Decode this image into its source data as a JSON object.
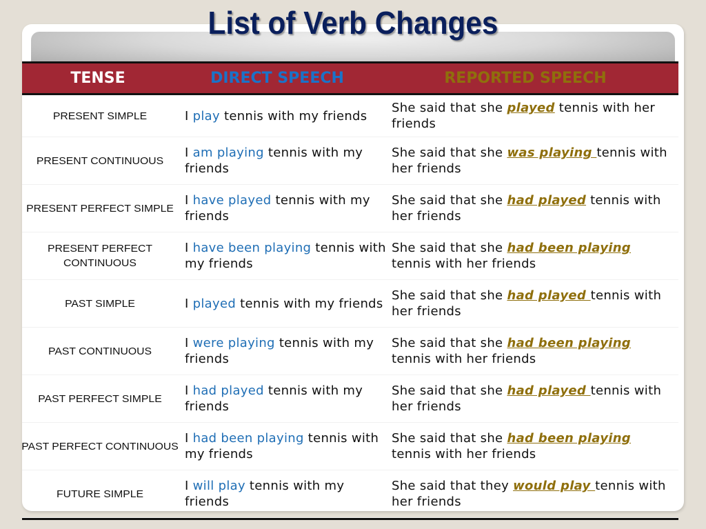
{
  "title": "List of Verb Changes",
  "colors": {
    "title": "#0a1f5c",
    "header_bg": "#a12734",
    "direct_accent": "#1f6eb5",
    "reported_accent": "#8f6f0c"
  },
  "table": {
    "headers": {
      "tense": "TENSE",
      "direct": "DIRECT SPEECH",
      "reported": "REPORTED SPEECH"
    },
    "rows": [
      {
        "tense": "PRESENT SIMPLE",
        "direct": {
          "pre": "I ",
          "verb": "play",
          "post": " tennis with my friends"
        },
        "reported": {
          "pre": "She said that she ",
          "verb": "played",
          "post": " tennis with her friends"
        }
      },
      {
        "tense": "PRESENT CONTINUOUS",
        "direct": {
          "pre": "I ",
          "verb": "am playing",
          "post": " tennis with my friends"
        },
        "reported": {
          "pre": "She said that she ",
          "verb": "was playing ",
          "post": "tennis with her friends"
        }
      },
      {
        "tense": "PRESENT PERFECT SIMPLE",
        "direct": {
          "pre": "I ",
          "verb": "have played",
          "post": " tennis with my friends"
        },
        "reported": {
          "pre": "She said that she ",
          "verb": "had played",
          "post": " tennis with her friends"
        }
      },
      {
        "tense": "PRESENT PERFECT CONTINUOUS",
        "direct": {
          "pre": "I ",
          "verb": "have been playing",
          "post": " tennis with my friends"
        },
        "reported": {
          "pre": "She said that she ",
          "verb": "had been playing",
          "post": " tennis with her friends"
        }
      },
      {
        "tense": "PAST SIMPLE",
        "direct": {
          "pre": "I ",
          "verb": "played",
          "post": " tennis with my friends"
        },
        "reported": {
          "pre": "She said that she ",
          "verb": "had played ",
          "post": "tennis with her friends"
        }
      },
      {
        "tense": "PAST CONTINUOUS",
        "direct": {
          "pre": "I ",
          "verb": "were playing",
          "post": " tennis with my friends"
        },
        "reported": {
          "pre": "She said that she ",
          "verb": "had been playing",
          "post": " tennis with her friends"
        }
      },
      {
        "tense": "PAST PERFECT SIMPLE",
        "direct": {
          "pre": "I ",
          "verb": "had played",
          "post": " tennis with my friends"
        },
        "reported": {
          "pre": "She said that she ",
          "verb": "had played ",
          "post": "tennis with her friends"
        }
      },
      {
        "tense": "PAST PERFECT CONTINUOUS",
        "direct": {
          "pre": "I ",
          "verb": "had been playing",
          "post": " tennis with my friends"
        },
        "reported": {
          "pre": "She said that she ",
          "verb": "had been playing",
          "post": " tennis with her friends"
        }
      },
      {
        "tense": "FUTURE SIMPLE",
        "direct": {
          "pre": "I ",
          "verb": "will play",
          "post": " tennis with my friends"
        },
        "reported": {
          "pre": "She said that they ",
          "verb": "would play ",
          "post": "tennis with her friends"
        }
      }
    ]
  }
}
